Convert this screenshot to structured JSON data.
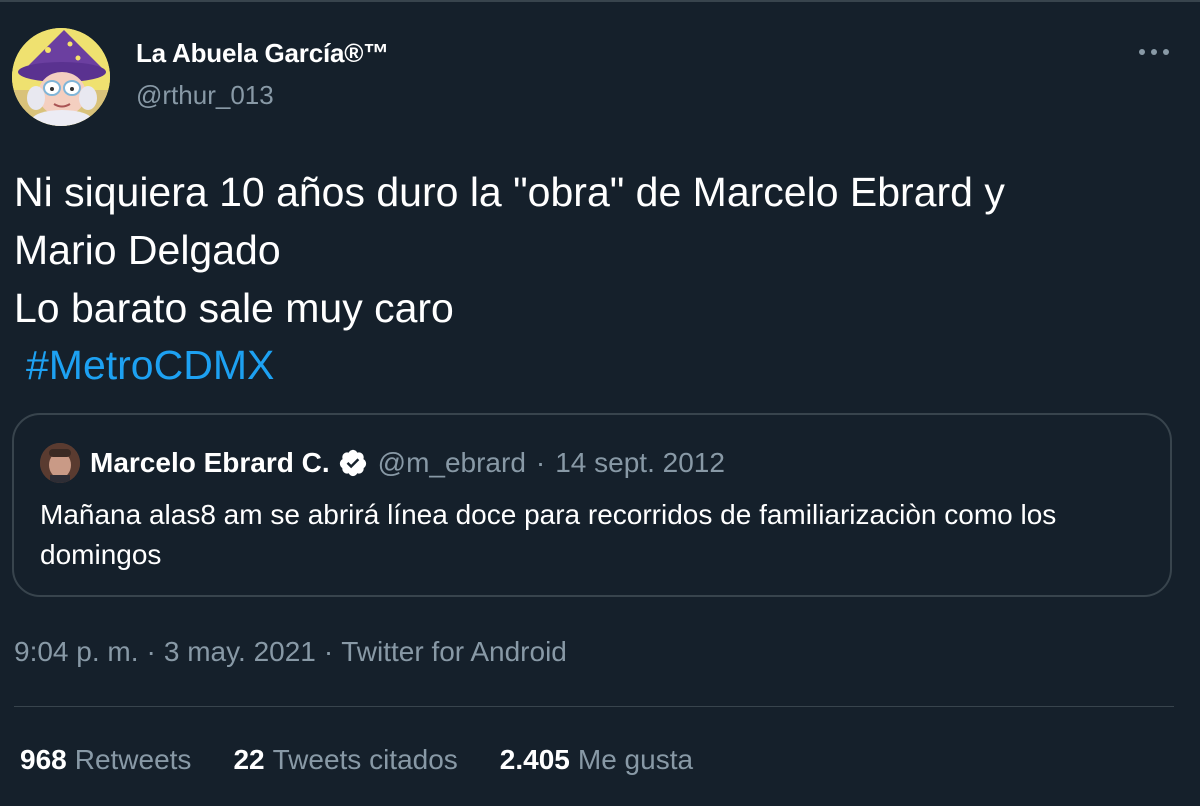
{
  "tweet": {
    "author": {
      "name": "La Abuela García®™",
      "handle": "@rthur_013"
    },
    "text_lines": [
      "Ni siquiera 10 años duro la \"obra\" de Marcelo Ebrard y",
      "Mario Delgado",
      "Lo barato sale muy caro"
    ],
    "hashtag": "#MetroCDMX",
    "quoted": {
      "name": "Marcelo Ebrard C.",
      "handle": "@m_ebrard",
      "separator": "·",
      "date": "14 sept. 2012",
      "text": "Mañana alas8 am se abrirá línea doce para recorridos de familiarizaciòn como los domingos"
    },
    "meta": {
      "time": "9:04 p. m.",
      "separator": "·",
      "date": "3 may. 2021",
      "source": "Twitter for Android"
    },
    "stats": {
      "retweets_count": "968",
      "retweets_label": "Retweets",
      "quotes_count": "22",
      "quotes_label": "Tweets citados",
      "likes_count": "2.405",
      "likes_label": "Me gusta"
    }
  },
  "icons": {
    "more": "more-horizontal-icon",
    "verified": "verified-badge-icon"
  },
  "colors": {
    "background": "#15202b",
    "accent": "#1da1f2",
    "secondary_text": "#8899a6",
    "border": "#38444d"
  }
}
